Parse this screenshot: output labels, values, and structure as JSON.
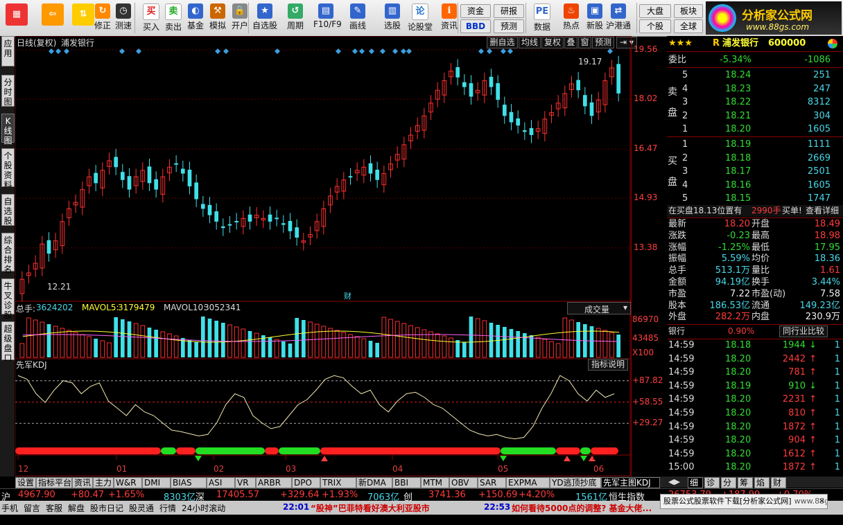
{
  "toolbar": {
    "items": [
      {
        "id": "tb-menu",
        "label": "",
        "icon": "grid-icon"
      },
      {
        "id": "tb-back",
        "label": "",
        "icon": "back-arrow-icon"
      },
      {
        "id": "tb-updown",
        "label": "",
        "icon": "up-down-icon"
      },
      {
        "id": "tb-modify",
        "label": "修正",
        "icon": "refresh-icon"
      },
      {
        "id": "tb-test",
        "label": "测速",
        "icon": "clock-icon"
      },
      {
        "id": "tb-buy",
        "label": "买入",
        "icon": "buy-icon",
        "glyph": "买"
      },
      {
        "id": "tb-sell",
        "label": "卖出",
        "icon": "sell-icon",
        "glyph": "卖"
      },
      {
        "id": "tb-fund",
        "label": "基金",
        "icon": "fund-icon"
      },
      {
        "id": "tb-sim",
        "label": "模拟",
        "icon": "hammer-icon"
      },
      {
        "id": "tb-open",
        "label": "开户",
        "icon": "lock-icon"
      },
      {
        "id": "tb-watch",
        "label": "自选股",
        "icon": "star-icon"
      },
      {
        "id": "tb-period",
        "label": "周期",
        "icon": "cycle-icon"
      },
      {
        "id": "tb-f10",
        "label": "F10/F9",
        "icon": "doc-icon"
      },
      {
        "id": "tb-draw",
        "label": "画线",
        "icon": "pencil-icon"
      },
      {
        "id": "tb-select",
        "label": "选股",
        "icon": "select-icon"
      },
      {
        "id": "tb-forum",
        "label": "论股堂",
        "icon": "forum-icon",
        "glyph": "论"
      },
      {
        "id": "tb-info",
        "label": "资讯",
        "icon": "info-icon"
      },
      {
        "id": "tb-data",
        "label": "数据",
        "icon": "pe-icon",
        "glyph": "PE"
      },
      {
        "id": "tb-hot",
        "label": "热点",
        "icon": "flame-icon"
      },
      {
        "id": "tb-new",
        "label": "新股",
        "icon": "newstock-icon"
      },
      {
        "id": "tb-hk",
        "label": "沪港通",
        "icon": "hk-icon"
      }
    ],
    "small": {
      "zijin": "资金",
      "bbd": "BBD",
      "yanbao": "研报",
      "yuce": "预测",
      "dapan": "大盘",
      "gegu": "个股",
      "bankuai": "板块",
      "quanqiu": "全球"
    }
  },
  "logo": {
    "name": "分析家公式网",
    "url": "www.88gs.com"
  },
  "lefttabs": [
    "应用",
    "分时图",
    "K线图",
    "个股资料",
    "自选股",
    "综合排名",
    "牛叉诊股",
    "超级盘口"
  ],
  "chart": {
    "title": "日线(复权)",
    "stock": "浦发银行",
    "buttons": [
      "删自选",
      "均线",
      "复权",
      "叠",
      "窗",
      "预测"
    ],
    "price_axis": [
      "19.56",
      "18.02",
      "16.47",
      "14.93",
      "13.38"
    ],
    "annot_high": "19.17",
    "annot_low": "12.21",
    "cai": "财",
    "vol": {
      "total_label": "总手:",
      "total": "3624202",
      "ma5_label": "MAVOL5:",
      "ma5": "3179479",
      "ma10_label": "MAVOL10:",
      "ma10": "3052341",
      "axis": [
        "86970",
        "43485",
        "X100"
      ],
      "dropdown": "成交量"
    },
    "kdj": {
      "name": "先军KDJ",
      "btn": "指标说明",
      "axis": [
        "+87.82",
        "+58.55",
        "+29.27"
      ]
    },
    "months": [
      "12",
      "01",
      "02",
      "03",
      "04",
      "05",
      "06"
    ]
  },
  "chart_data": {
    "type": "line",
    "title": "",
    "xlabel": "",
    "ylabel": "",
    "candle_close": [
      12.4,
      12.6,
      12.9,
      13.5,
      13.2,
      13.6,
      14.2,
      14.6,
      14.8,
      15.2,
      15.6,
      15.4,
      15.8,
      16.1,
      15.9,
      15.5,
      15.2,
      15.6,
      15.8,
      15.4,
      15.2,
      15.6,
      15.9,
      16.0,
      15.7,
      15.3,
      14.9,
      14.6,
      14.4,
      14.2,
      14.0,
      14.1,
      14.2,
      14.3,
      14.2,
      14.4,
      14.3,
      14.2,
      14.3,
      14.1,
      13.9,
      13.7,
      13.6,
      13.8,
      14.2,
      14.6,
      15.0,
      15.3,
      15.5,
      15.6,
      15.8,
      15.9,
      15.7,
      15.5,
      15.7,
      16.0,
      16.3,
      16.6,
      16.9,
      17.2,
      17.5,
      17.9,
      18.3,
      18.6,
      18.9,
      18.7,
      18.4,
      18.1,
      18.3,
      18.6,
      18.4,
      18.0,
      17.5,
      17.3,
      17.2,
      17.0,
      16.9,
      17.1,
      17.4,
      17.6,
      17.9,
      18.2,
      18.5,
      18.3,
      17.8,
      17.5,
      18.0,
      18.6,
      19.0,
      18.2
    ],
    "volume_series": [
      {
        "name": "MAVOL5",
        "color": "#ffff33"
      },
      {
        "name": "MAVOL10",
        "color": "#ff66ff"
      }
    ],
    "y_range": [
      12.21,
      19.56
    ],
    "kdj_range": [
      0,
      100
    ]
  },
  "orderbook": {
    "stars": "★★★",
    "code_prefix": "R",
    "name": "浦发银行",
    "code": "600000",
    "weibi_label": "委比",
    "weibi": "-5.34%",
    "weicha": "-1086",
    "sell_label": "卖盘",
    "buy_label": "买盘",
    "sells": [
      {
        "n": "5",
        "p": "18.24",
        "v": "251"
      },
      {
        "n": "4",
        "p": "18.23",
        "v": "247"
      },
      {
        "n": "3",
        "p": "18.22",
        "v": "8312"
      },
      {
        "n": "2",
        "p": "18.21",
        "v": "304"
      },
      {
        "n": "1",
        "p": "18.20",
        "v": "1605"
      }
    ],
    "buys": [
      {
        "n": "1",
        "p": "18.19",
        "v": "1111"
      },
      {
        "n": "2",
        "p": "18.18",
        "v": "2669"
      },
      {
        "n": "3",
        "p": "18.17",
        "v": "2501"
      },
      {
        "n": "4",
        "p": "18.16",
        "v": "1605"
      },
      {
        "n": "5",
        "p": "18.15",
        "v": "1747"
      }
    ],
    "notice": "在买盘18.13位置有",
    "notice_vol": "2990手",
    "notice_act": "买单!",
    "notice_link": "查看详细"
  },
  "quote": [
    [
      "最新",
      "18.20",
      "开盘",
      "18.49"
    ],
    [
      "涨跌",
      "-0.23",
      "最高",
      "18.98"
    ],
    [
      "涨幅",
      "-1.25%",
      "最低",
      "17.95"
    ],
    [
      "振幅",
      "5.59%",
      "均价",
      "18.36"
    ],
    [
      "总手",
      "513.1万",
      "量比",
      "1.61"
    ],
    [
      "金额",
      "94.19亿",
      "换手",
      "3.44%"
    ],
    [
      "市盈",
      "7.22",
      "市盈(动)",
      "7.58"
    ],
    [
      "股本",
      "186.53亿",
      "流通",
      "149.23亿"
    ],
    [
      "外盘",
      "282.2万",
      "内盘",
      "230.9万"
    ]
  ],
  "industry": {
    "name": "银行",
    "pct": "0.90%",
    "btn": "同行业比较"
  },
  "ticks": [
    [
      "14:59",
      "18.18",
      "1944",
      "down",
      "1"
    ],
    [
      "14:59",
      "18.20",
      "2442",
      "up",
      "1"
    ],
    [
      "14:59",
      "18.20",
      "781",
      "up",
      "1"
    ],
    [
      "14:59",
      "18.19",
      "910",
      "down",
      "1"
    ],
    [
      "14:59",
      "18.20",
      "2231",
      "up",
      "1"
    ],
    [
      "14:59",
      "18.20",
      "810",
      "up",
      "1"
    ],
    [
      "14:59",
      "18.20",
      "1872",
      "up",
      "1"
    ],
    [
      "14:59",
      "18.20",
      "904",
      "up",
      "1"
    ],
    [
      "14:59",
      "18.20",
      "1612",
      "up",
      "1"
    ],
    [
      "15:00",
      "18.20",
      "1872",
      "up",
      "1"
    ]
  ],
  "bottomtabs": [
    "设置",
    "指标平台",
    "资讯",
    "主力",
    "W&R",
    "DMI",
    "BIAS",
    "ASI",
    "VR",
    "ARBR",
    "DPO",
    "TRIX",
    "新DMA",
    "BBI",
    "MTM",
    "OBV",
    "SAR",
    "EXPMA",
    "YD逃顶抄底",
    "先军主图KDJ"
  ],
  "righttabs": [
    "细",
    "诊",
    "分",
    "筹",
    "焰",
    "财"
  ],
  "index": {
    "sh_label": "沪",
    "sh": "4967.90",
    "sh_chg": "+80.47",
    "sh_pct": "+1.65%",
    "sh_amt": "8303亿",
    "sz_label": "深",
    "sz": "17405.57",
    "sz_chg": "+329.64",
    "sz_pct": "+1.93%",
    "sz_amt": "7063亿",
    "cy_label": "创",
    "cy": "3741.36",
    "cy_chg": "+150.69",
    "cy_pct": "+4.20%",
    "cy_amt": "1561亿",
    "hs_label": "恒生指数",
    "hs": "26753.79",
    "hs_chg": "+187.99",
    "hs_pct": "+0.70%"
  },
  "status": {
    "items": [
      "手机",
      "留言",
      "客服",
      "解盘",
      "股市日记",
      "股灵通",
      "行情",
      "24小时滚动"
    ],
    "news1_time": "22:01",
    "news1": "“股神”巴菲特看好澳大利亚股市",
    "news2_time": "22:53",
    "news2": "如何看待5000点的调整? 基金大佬...",
    "ad": "股票公式股票软件下载[分析家公式网]",
    "ad_url": "www.88gs.com"
  }
}
